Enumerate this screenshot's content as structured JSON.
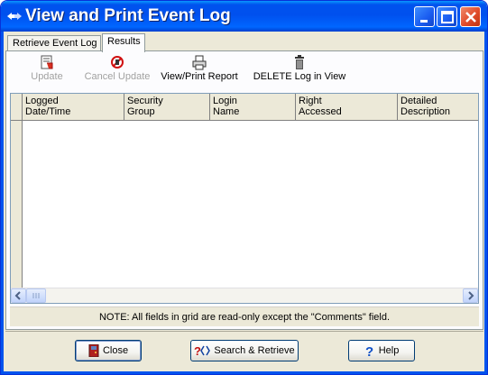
{
  "window": {
    "title": "View and Print Event Log"
  },
  "tabs": [
    {
      "label": "Retrieve Event Log",
      "active": false
    },
    {
      "label": "Results",
      "active": true
    }
  ],
  "toolbar": {
    "update": {
      "label": "Update",
      "icon": "update-icon",
      "enabled": false
    },
    "cancel_update": {
      "label": "Cancel Update",
      "icon": "cancel-icon",
      "enabled": false
    },
    "view_print_report": {
      "label": "View/Print Report",
      "icon": "printer-icon",
      "enabled": true
    },
    "delete_log": {
      "label": "DELETE Log in View",
      "icon": "trash-icon",
      "enabled": true
    }
  },
  "grid": {
    "columns": [
      "Logged\nDate/Time",
      "Security\nGroup",
      "Login\nName",
      "Right\nAccessed",
      "Detailed\nDescription"
    ],
    "rows": []
  },
  "note": "NOTE: All fields in grid are read-only except the \"Comments\" field.",
  "buttons": {
    "close": {
      "label": "Close",
      "icon": "door-icon"
    },
    "search": {
      "label": "Search & Retrieve",
      "icon": "search-retrieve-icon"
    },
    "help": {
      "label": "Help",
      "icon": "help-icon"
    }
  },
  "colors": {
    "titlebar": "#0053ee",
    "face": "#ece9d8"
  }
}
